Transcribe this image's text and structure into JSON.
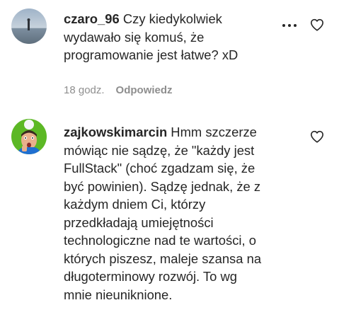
{
  "comments": [
    {
      "username": "czaro_96",
      "lines": [
        "Czy kiedykolwiek",
        "wydawało się komuś, że",
        "programowanie jest łatwe? xD"
      ],
      "time": "18 godz.",
      "reply_label": "Odpowiedz",
      "avatar_icon": "avatar-landscape-icon",
      "more_icon": "more-options-icon",
      "like_icon": "heart-outline-icon"
    },
    {
      "username": "zajkowskimarcin",
      "first_line_text": " Hmm szczerze",
      "lines": [
        "mówiąc nie sądzę, że \"każdy jest",
        "FullStack\" (choć zgadzam się, że",
        "być powinien). Sądzę jednak, że z",
        "każdym dniem Ci, którzy",
        "przedkładają umiejętności",
        "technologiczne nad te wartości, o",
        "których piszesz, maleje szansa na",
        "długoterminowy rozwój. To wg",
        "mnie nieuniknione."
      ],
      "avatar_icon": "avatar-person-icon",
      "like_icon": "heart-outline-icon"
    }
  ],
  "colors": {
    "text": "#262626",
    "secondary": "#8e8e8e"
  }
}
